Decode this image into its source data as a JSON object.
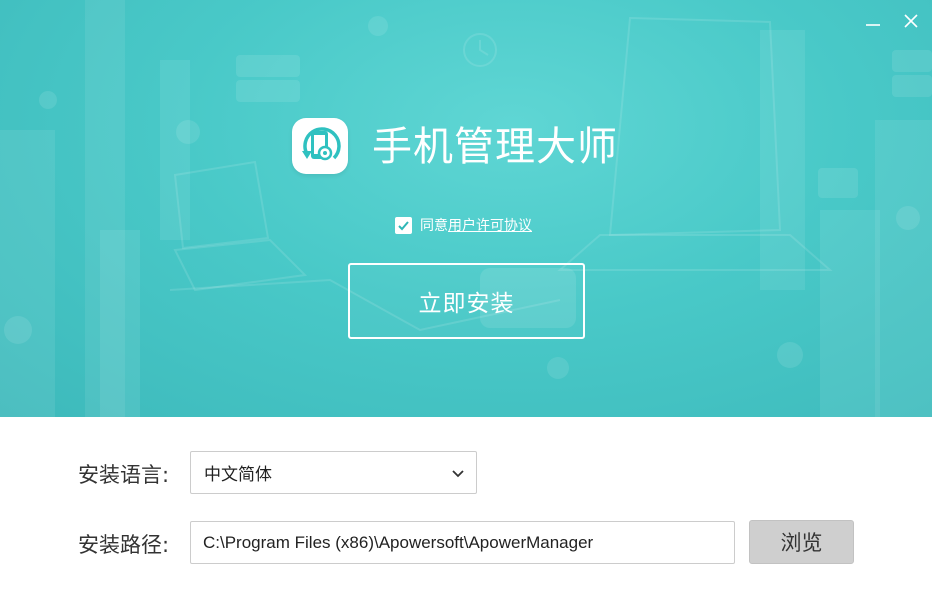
{
  "window": {
    "minimize_icon": "minimize-icon",
    "close_icon": "close-icon"
  },
  "hero": {
    "app_title": "手机管理大师",
    "logo_icon": "phone-manager-logo-icon",
    "agreement": {
      "checked": true,
      "prefix": "同意",
      "link_text": "用户许可协议"
    },
    "install_button": "立即安装"
  },
  "settings": {
    "language_label": "安装语言:",
    "language_value": "中文简体",
    "path_label": "安装路径:",
    "path_value": "C:\\Program Files (x86)\\Apowersoft\\ApowerManager",
    "browse_button": "浏览"
  },
  "colors": {
    "hero_teal": "#49c9c8",
    "logo_teal": "#2fc1c0",
    "browse_gray": "#cfcfcf"
  }
}
